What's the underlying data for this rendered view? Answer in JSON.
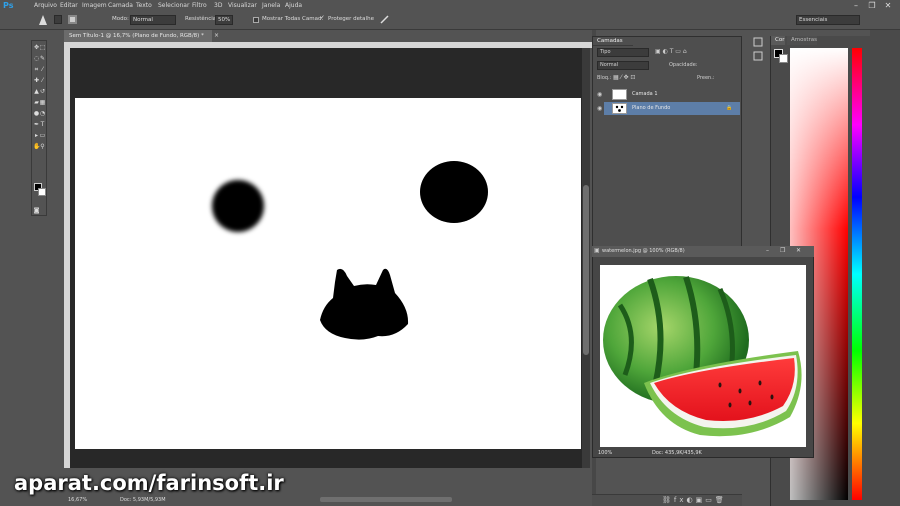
{
  "app": {
    "logo": "Ps"
  },
  "menu": [
    "Arquivo",
    "Editar",
    "Imagem",
    "Camada",
    "Texto",
    "Selecionar",
    "Filtro",
    "3D",
    "Visualizar",
    "Janela",
    "Ajuda"
  ],
  "window_controls": {
    "minimize": "–",
    "restore": "❐",
    "close": "✕"
  },
  "options": {
    "mode_label": "Modo:",
    "mode_value": "Normal",
    "strength_label": "Resistência:",
    "strength_value": "50%",
    "sample_all_label": "Mostrar Todas Camad.",
    "protect_detail_label": "Proteger detalhe",
    "workspace_value": "Essenciais"
  },
  "document": {
    "tab_title": "Sem Título-1 @ 16,7% (Plano de Fundo, RGB/8) *"
  },
  "status": {
    "zoom": "16,67%",
    "doc_info": "Doc: 5,93M/5,93M"
  },
  "layers_panel": {
    "tabs": [
      "Camadas"
    ],
    "filter_value": "Tipo",
    "blend_value": "Normal",
    "opacity_label": "Opacidade:",
    "lock_label": "Bloq.:",
    "fill_label": "Preen.:",
    "layers": [
      {
        "name": "Camada 1",
        "selected": false
      },
      {
        "name": "Plano de Fundo",
        "selected": true
      }
    ]
  },
  "color_panel": {
    "tabs": [
      "Cor",
      "Amostras"
    ]
  },
  "image_window": {
    "title": "watermelon.jpg @ 100% (RGB/8)",
    "zoom": "100%",
    "doc_info": "Doc: 435,9K/435,9K"
  },
  "watermark": "aparat.com/farinsoft.ir",
  "colors": {
    "accent": "#2fa0e8",
    "selected_layer": "#5d7ea8",
    "workspace": "#282828"
  }
}
